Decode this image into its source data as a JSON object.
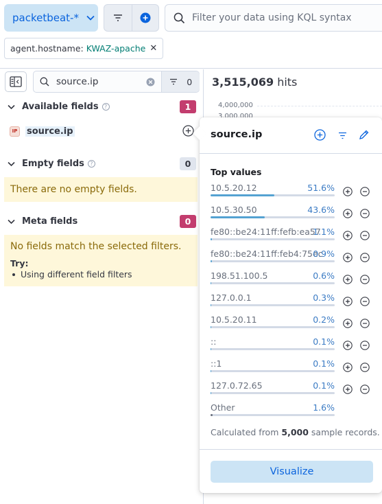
{
  "header": {
    "data_view_label": "packetbeat-*",
    "search_placeholder": "Filter your data using KQL syntax"
  },
  "filter_pill": {
    "key": "agent.hostname:",
    "value": "KWAZ-apache"
  },
  "sidebar": {
    "search_value": "source.ip",
    "filter_count": "0",
    "available": {
      "label": "Available fields",
      "count": "1"
    },
    "field": {
      "type_token": "IP",
      "name": "source.ip"
    },
    "empty": {
      "label": "Empty fields",
      "count": "0",
      "message": "There are no empty fields."
    },
    "meta": {
      "label": "Meta fields",
      "count": "0",
      "message": "No fields match the selected filters.",
      "try_label": "Try:",
      "tip": "Using different field filters"
    }
  },
  "main": {
    "hits_value": "3,515,069",
    "hits_label": "hits",
    "y_tick_top": "4,000,000",
    "y_tick_partial": "3,000,000"
  },
  "popover": {
    "title": "source.ip",
    "top_values_title": "Top values",
    "values": [
      {
        "name": "10.5.20.12",
        "pct_text": "51.6%",
        "pct": 51.6
      },
      {
        "name": "10.5.30.50",
        "pct_text": "43.6%",
        "pct": 43.6
      },
      {
        "name": "fe80::be24:11ff:fefb:ea57",
        "pct_text": "1.1%",
        "pct": 1.1
      },
      {
        "name": "fe80::be24:11ff:feb4:75ec",
        "pct_text": "0.9%",
        "pct": 0.9
      },
      {
        "name": "198.51.100.5",
        "pct_text": "0.6%",
        "pct": 0.6
      },
      {
        "name": "127.0.0.1",
        "pct_text": "0.3%",
        "pct": 0.3
      },
      {
        "name": "10.5.20.11",
        "pct_text": "0.2%",
        "pct": 0.2
      },
      {
        "name": "::",
        "pct_text": "0.1%",
        "pct": 0.1
      },
      {
        "name": "::1",
        "pct_text": "0.1%",
        "pct": 0.1
      },
      {
        "name": "127.0.72.65",
        "pct_text": "0.1%",
        "pct": 0.1
      },
      {
        "name": "Other",
        "pct_text": "1.6%",
        "pct": 1.6
      }
    ],
    "calc_prefix": "Calculated from",
    "calc_count": "5,000",
    "calc_suffix": "sample records.",
    "visualize_label": "Visualize"
  },
  "colors": {
    "accent": "#0b64dd",
    "bar": "#54a2d2",
    "badge_pink": "#c33d6e",
    "note_bg": "#fef7da"
  }
}
